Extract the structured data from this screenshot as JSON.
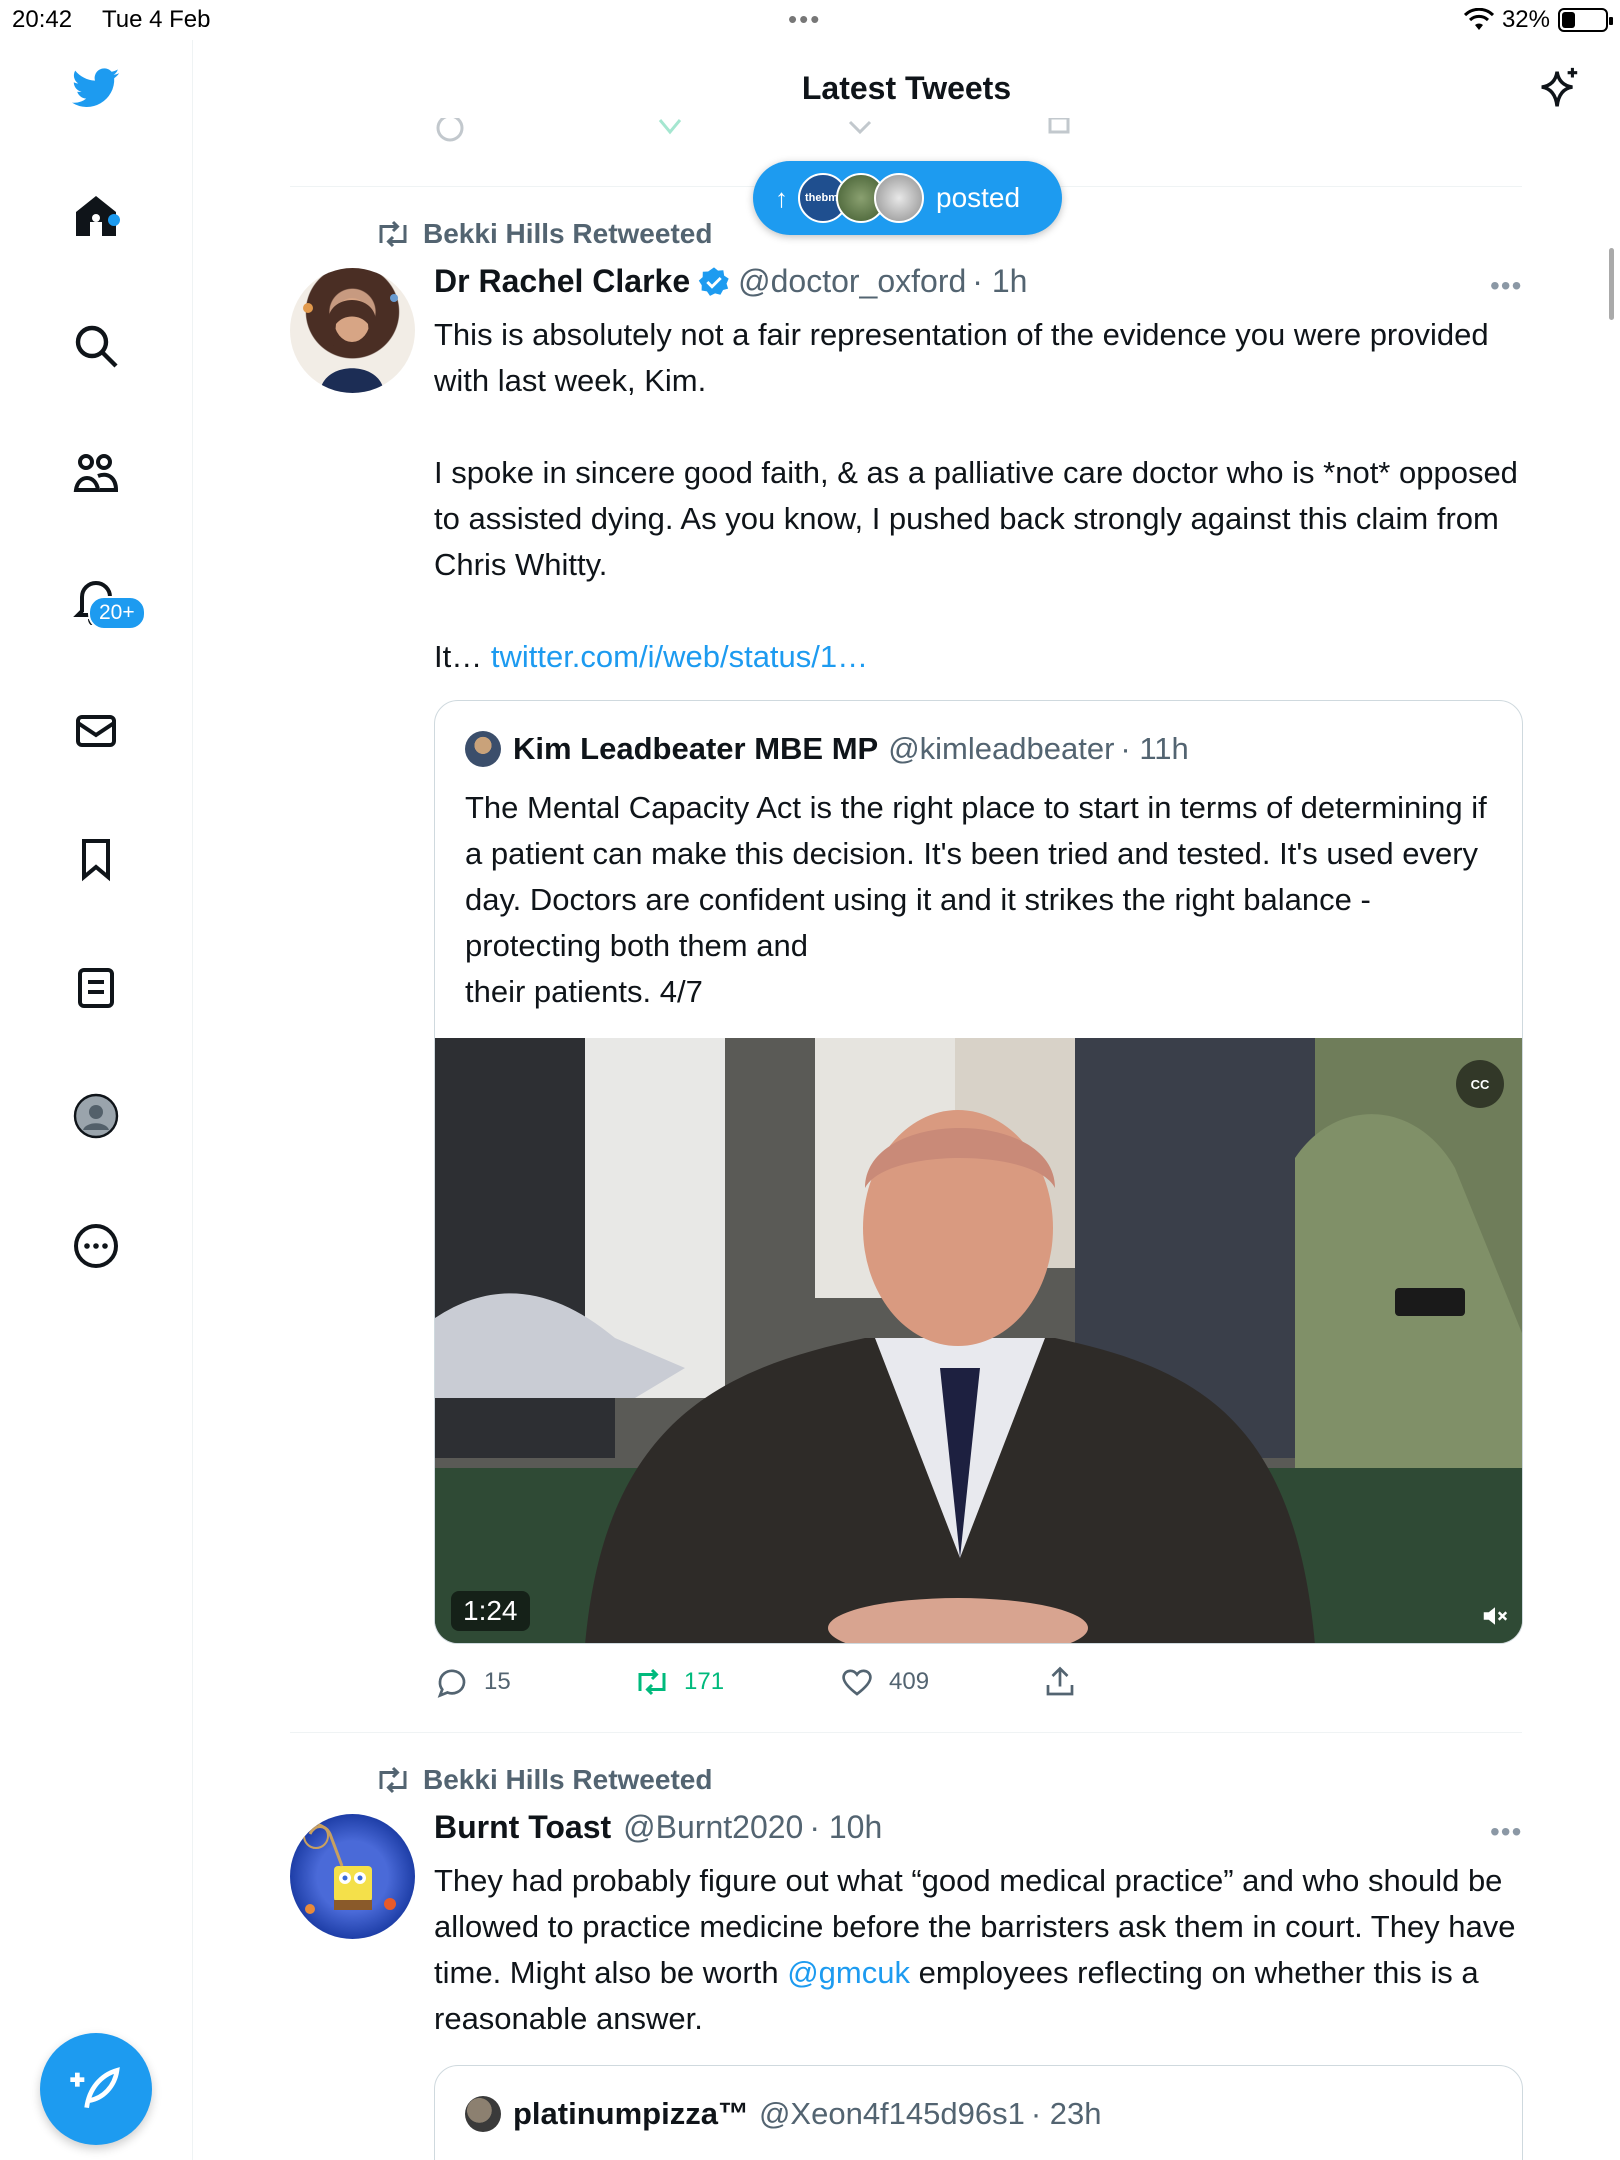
{
  "status_bar": {
    "time": "20:42",
    "date": "Tue 4 Feb",
    "battery": "32%",
    "battery_fraction": 0.32
  },
  "header": {
    "title": "Latest Tweets"
  },
  "sidebar": {
    "notification_badge": "20+"
  },
  "new_posts_pill": {
    "label": "posted",
    "avatar_label": "thebmj"
  },
  "tweets": [
    {
      "retweeted_by": "Bekki Hills Retweeted",
      "name": "Dr Rachel Clarke",
      "handle": "@doctor_oxford",
      "time": "· 1h",
      "text": "This is absolutely not a fair representation of the evidence you were provided with last week, Kim.\n\nI spoke in sincere good faith, & as a palliative care doctor who is *not* opposed to assisted dying. As you know, I pushed back strongly against this claim from Chris Whitty.\n\n",
      "text_tail": "It… ",
      "link": "twitter.com/i/web/status/1…",
      "quote": {
        "name": "Kim Leadbeater MBE MP",
        "handle": "@kimleadbeater",
        "time": "· 11h",
        "text": "The Mental Capacity Act is the right place to start in terms of determining if a patient can make this decision. It's been tried and tested. It's used every day. Doctors are confident using it and it strikes the right balance - protecting both them and\ntheir patients. 4/7",
        "video_duration": "1:24",
        "cc_label": "CC"
      },
      "replies": "15",
      "retweets": "171",
      "likes": "409"
    },
    {
      "retweeted_by": "Bekki Hills Retweeted",
      "name": "Burnt Toast",
      "handle": "@Burnt2020",
      "time": "· 10h",
      "text_a": "They had probably figure out what “good medical practice” and who should be allowed to practice medicine before the barristers ask them in court. They have time. Might also be worth ",
      "mention": "@gmcuk",
      "text_b": " employees reflecting on whether this is a reasonable answer.",
      "quote": {
        "name": "platinumpizza™",
        "handle": "@Xeon4f145d96s1",
        "time": "· 23h"
      }
    }
  ],
  "colors": {
    "accent": "#1d9bf0",
    "retweet_green": "#00ba7c",
    "secondary_text": "#536471"
  }
}
